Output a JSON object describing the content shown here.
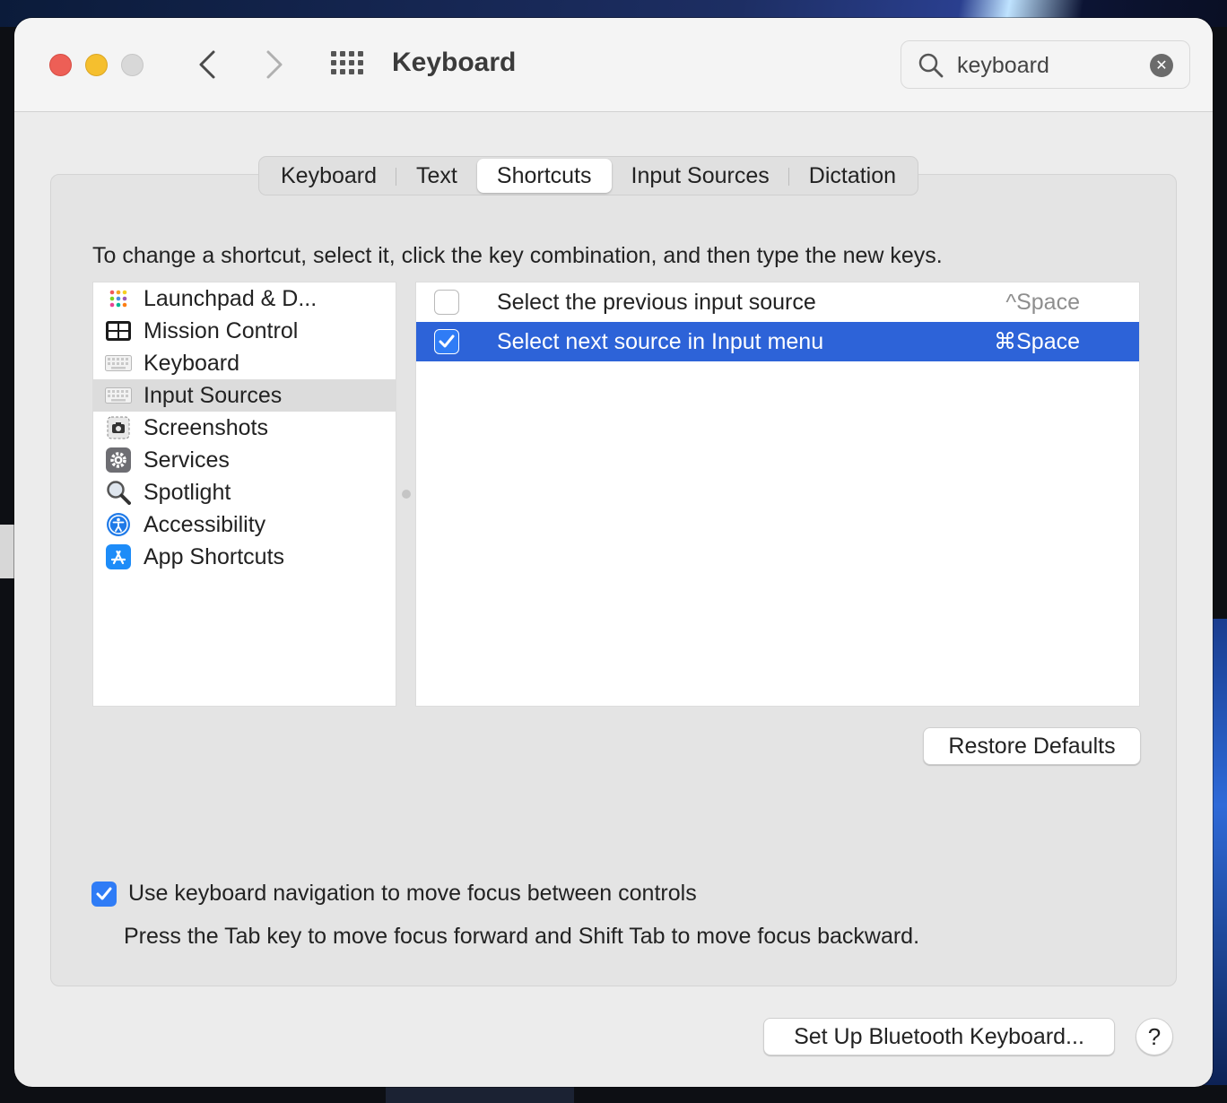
{
  "window": {
    "title": "Keyboard",
    "search": {
      "value": "keyboard",
      "placeholder": "Search"
    }
  },
  "tabs": [
    {
      "label": "Keyboard"
    },
    {
      "label": "Text"
    },
    {
      "label": "Shortcuts"
    },
    {
      "label": "Input Sources"
    },
    {
      "label": "Dictation"
    }
  ],
  "active_tab": "Shortcuts",
  "instruction": "To change a shortcut, select it, click the key combination, and then type the new keys.",
  "categories": [
    {
      "label": "Launchpad & D...",
      "icon": "launchpad-icon"
    },
    {
      "label": "Mission Control",
      "icon": "mission-control-icon"
    },
    {
      "label": "Keyboard",
      "icon": "keyboard-icon"
    },
    {
      "label": "Input Sources",
      "icon": "keyboard-icon",
      "selected": true
    },
    {
      "label": "Screenshots",
      "icon": "screenshot-icon"
    },
    {
      "label": "Services",
      "icon": "gear-icon"
    },
    {
      "label": "Spotlight",
      "icon": "magnifier-icon"
    },
    {
      "label": "Accessibility",
      "icon": "accessibility-icon"
    },
    {
      "label": "App Shortcuts",
      "icon": "app-store-icon"
    }
  ],
  "shortcuts": [
    {
      "label": "Select the previous input source",
      "key": "^Space",
      "checked": false,
      "selected": false
    },
    {
      "label": "Select next source in Input menu",
      "key": "⌘Space",
      "checked": true,
      "selected": true
    }
  ],
  "buttons": {
    "restore_defaults": "Restore Defaults",
    "bluetooth": "Set Up Bluetooth Keyboard...",
    "help": "?"
  },
  "keyboard_navigation": {
    "label": "Use keyboard navigation to move focus between controls",
    "help": "Press the Tab key to move focus forward and Shift Tab to move focus backward.",
    "checked": true
  },
  "colors": {
    "selection": "#2d63d8",
    "checkbox_accent": "#2f7cf6"
  }
}
